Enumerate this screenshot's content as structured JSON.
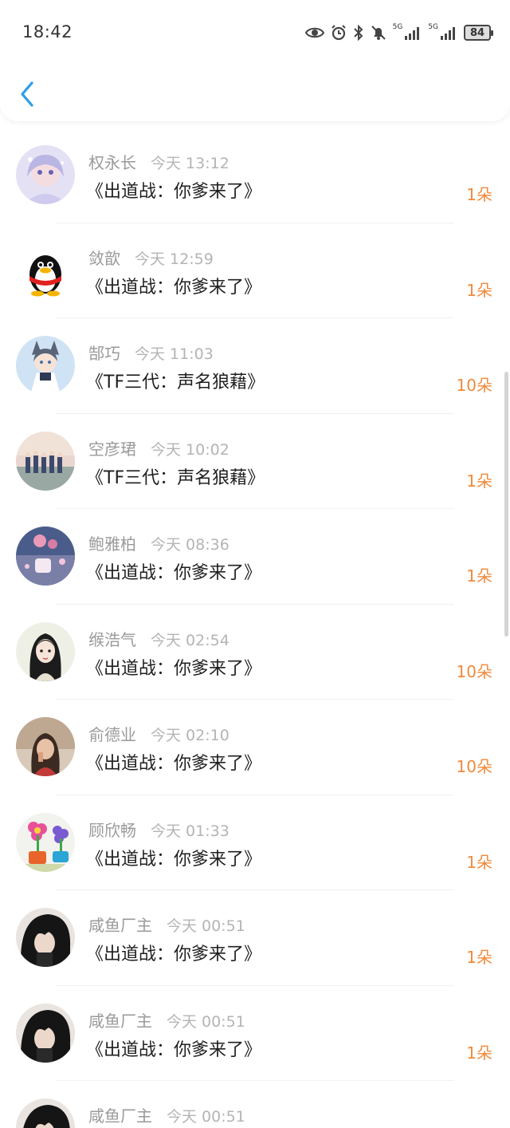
{
  "status_bar": {
    "time": "18:42",
    "signal1_label": "5G",
    "signal2_label": "5G",
    "battery": "84",
    "icons": [
      "eye-icon",
      "alarm-icon",
      "bluetooth-icon",
      "mute-bell-icon",
      "signal-icon",
      "signal-icon",
      "battery-icon"
    ]
  },
  "header": {
    "back_icon": "chevron-left-icon",
    "accent_color": "#2a9fe6"
  },
  "gift_color": "#f08a3c",
  "list": [
    {
      "name": "权永长",
      "time": "今天 13:12",
      "title": "《出道战：你爹来了》",
      "count": "1朵",
      "avatar": "anime-girl-avatar"
    },
    {
      "name": "敛歆",
      "time": "今天 12:59",
      "title": "《出道战：你爹来了》",
      "count": "1朵",
      "avatar": "qq-penguin-avatar"
    },
    {
      "name": "郜巧",
      "time": "今天 11:03",
      "title": "《TF三代：声名狼藉》",
      "count": "10朵",
      "avatar": "anime-catgirl-avatar"
    },
    {
      "name": "空彦珺",
      "time": "今天 10:02",
      "title": "《TF三代：声名狼藉》",
      "count": "1朵",
      "avatar": "group-photo-avatar"
    },
    {
      "name": "鲍雅柏",
      "time": "今天 08:36",
      "title": "《出道战：你爹来了》",
      "count": "1朵",
      "avatar": "pink-scene-avatar"
    },
    {
      "name": "缑浩气",
      "time": "今天 02:54",
      "title": "《出道战：你爹来了》",
      "count": "10朵",
      "avatar": "illustrated-girl-avatar"
    },
    {
      "name": "俞德业",
      "time": "今天 02:10",
      "title": "《出道战：你爹来了》",
      "count": "10朵",
      "avatar": "photo-girl-avatar"
    },
    {
      "name": "顾欣畅",
      "time": "今天 01:33",
      "title": "《出道战：你爹来了》",
      "count": "1朵",
      "avatar": "flower-toy-avatar"
    },
    {
      "name": "咸鱼厂主",
      "time": "今天 00:51",
      "title": "《出道战：你爹来了》",
      "count": "1朵",
      "avatar": "dark-hair-avatar"
    },
    {
      "name": "咸鱼厂主",
      "time": "今天 00:51",
      "title": "《出道战：你爹来了》",
      "count": "1朵",
      "avatar": "dark-hair-avatar"
    },
    {
      "name": "咸鱼厂主",
      "time": "今天 00:51",
      "title": "",
      "count": "",
      "avatar": "dark-hair-avatar"
    }
  ]
}
